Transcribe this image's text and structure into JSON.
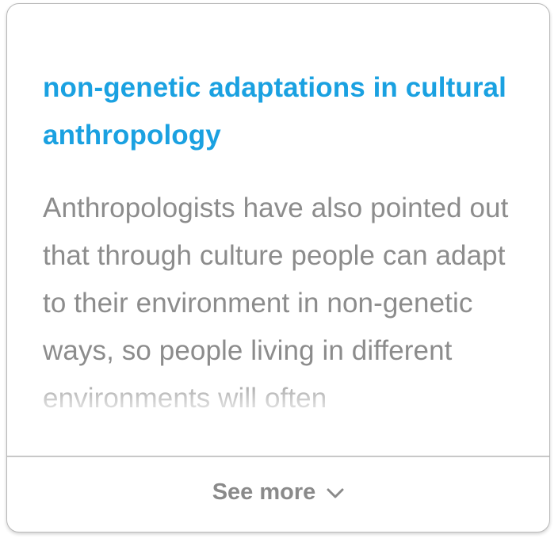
{
  "card": {
    "title": "non-genetic adaptations in cultural anthropology",
    "body": "Anthropologists have also pointed out that through culture people can adapt to their environment in non-genetic ways, so people living in different environments will often",
    "accent_color": "#1aa1e1",
    "text_color": "#8c8c8c"
  },
  "footer": {
    "see_more_label": "See more",
    "icon": "chevron-down-icon"
  }
}
